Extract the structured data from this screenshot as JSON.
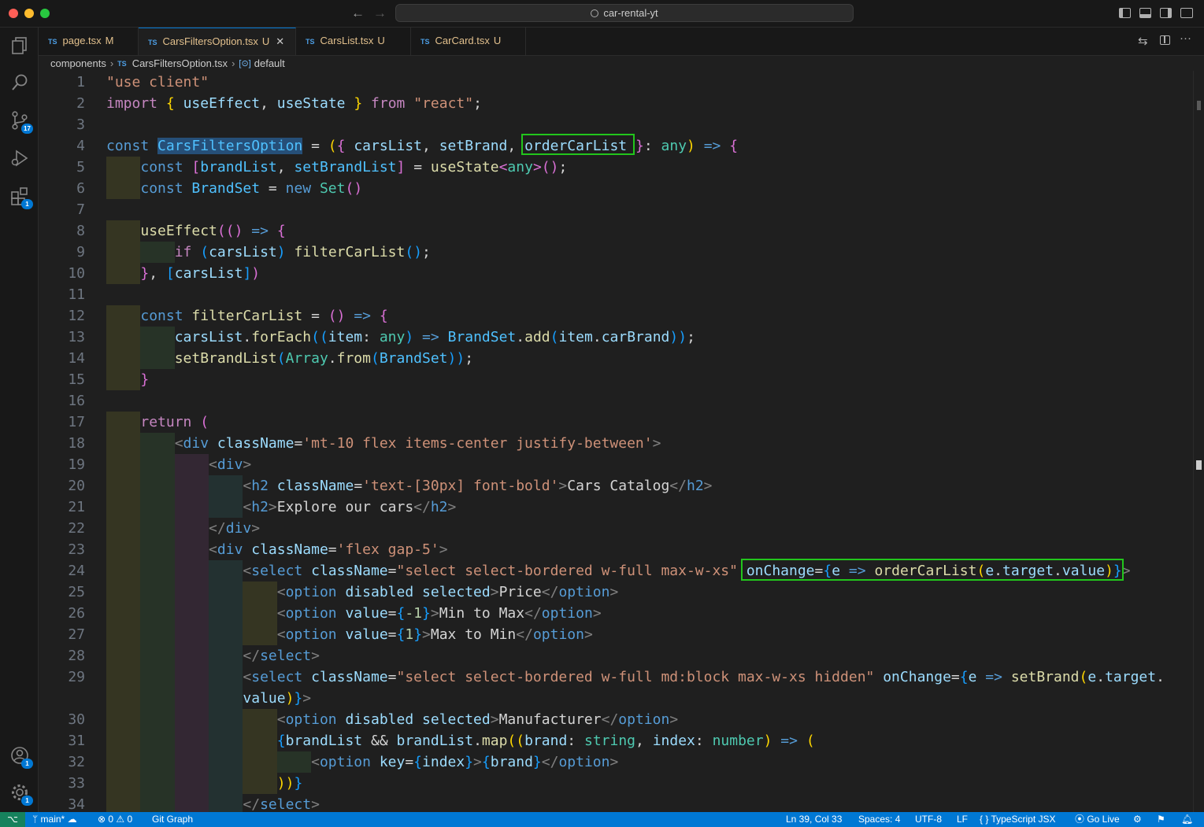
{
  "window": {
    "search_text": "car-rental-yt"
  },
  "tabs": [
    {
      "name": "page.tsx",
      "status": "M"
    },
    {
      "name": "CarsFiltersOption.tsx",
      "status": "U"
    },
    {
      "name": "CarsList.tsx",
      "status": "U"
    },
    {
      "name": "CarCard.tsx",
      "status": "U"
    }
  ],
  "tab_lang": "TS",
  "breadcrumb": {
    "folder": "components",
    "file": "CarsFiltersOption.tsx",
    "symbol": "default"
  },
  "activity_badges": {
    "source_control": "17",
    "extensions": "1",
    "accounts": "1",
    "manage": "1"
  },
  "line_numbers": [
    "1",
    "2",
    "3",
    "4",
    "5",
    "6",
    "7",
    "8",
    "9",
    "10",
    "11",
    "12",
    "13",
    "14",
    "15",
    "16",
    "17",
    "18",
    "19",
    "20",
    "21",
    "22",
    "23",
    "24",
    "25",
    "26",
    "27",
    "28",
    "29",
    "",
    "30",
    "31",
    "32",
    "33",
    "34"
  ],
  "code": [
    "\"use client\"",
    "import { useEffect, useState } from \"react\";",
    "",
    "const CarsFiltersOption = ({ carsList, setBrand, orderCarList }: any) => {",
    "    const [brandList, setBrandList] = useState<any>();",
    "    const BrandSet = new Set()",
    "",
    "    useEffect(() => {",
    "        if (carsList) filterCarList();",
    "    }, [carsList])",
    "",
    "    const filterCarList = () => {",
    "        carsList.forEach((item: any) => BrandSet.add(item.carBrand));",
    "        setBrandList(Array.from(BrandSet));",
    "    }",
    "",
    "    return (",
    "        <div className='mt-10 flex items-center justify-between'>",
    "            <div>",
    "                <h2 className='text-[30px] font-bold'>Cars Catalog</h2>",
    "                <h2>Explore our cars</h2>",
    "            </div>",
    "            <div className='flex gap-5'>",
    "                <select className=\"select select-bordered w-full max-w-xs\" onChange={e => orderCarList(e.target.value)}>",
    "                    <option disabled selected>Price</option>",
    "                    <option value={-1}>Min to Max</option>",
    "                    <option value={1}>Max to Min</option>",
    "                </select>",
    "                <select className=\"select select-bordered w-full md:block max-w-xs hidden\" onChange={e => setBrand(e.target.",
    "                value)}>",
    "                    <option disabled selected>Manufacturer</option>",
    "                    {brandList && brandList.map((brand: string, index: number) => (",
    "                        <option key={index}>{brand}</option>",
    "                    ))}",
    "                </select>"
  ],
  "status": {
    "branch": "main*",
    "errors": "0",
    "warnings": "0",
    "git_graph": "Git Graph",
    "position": "Ln 39, Col 33",
    "spaces": "Spaces: 4",
    "encoding": "UTF-8",
    "eol": "LF",
    "language": "TypeScript JSX",
    "golive": "Go Live"
  }
}
